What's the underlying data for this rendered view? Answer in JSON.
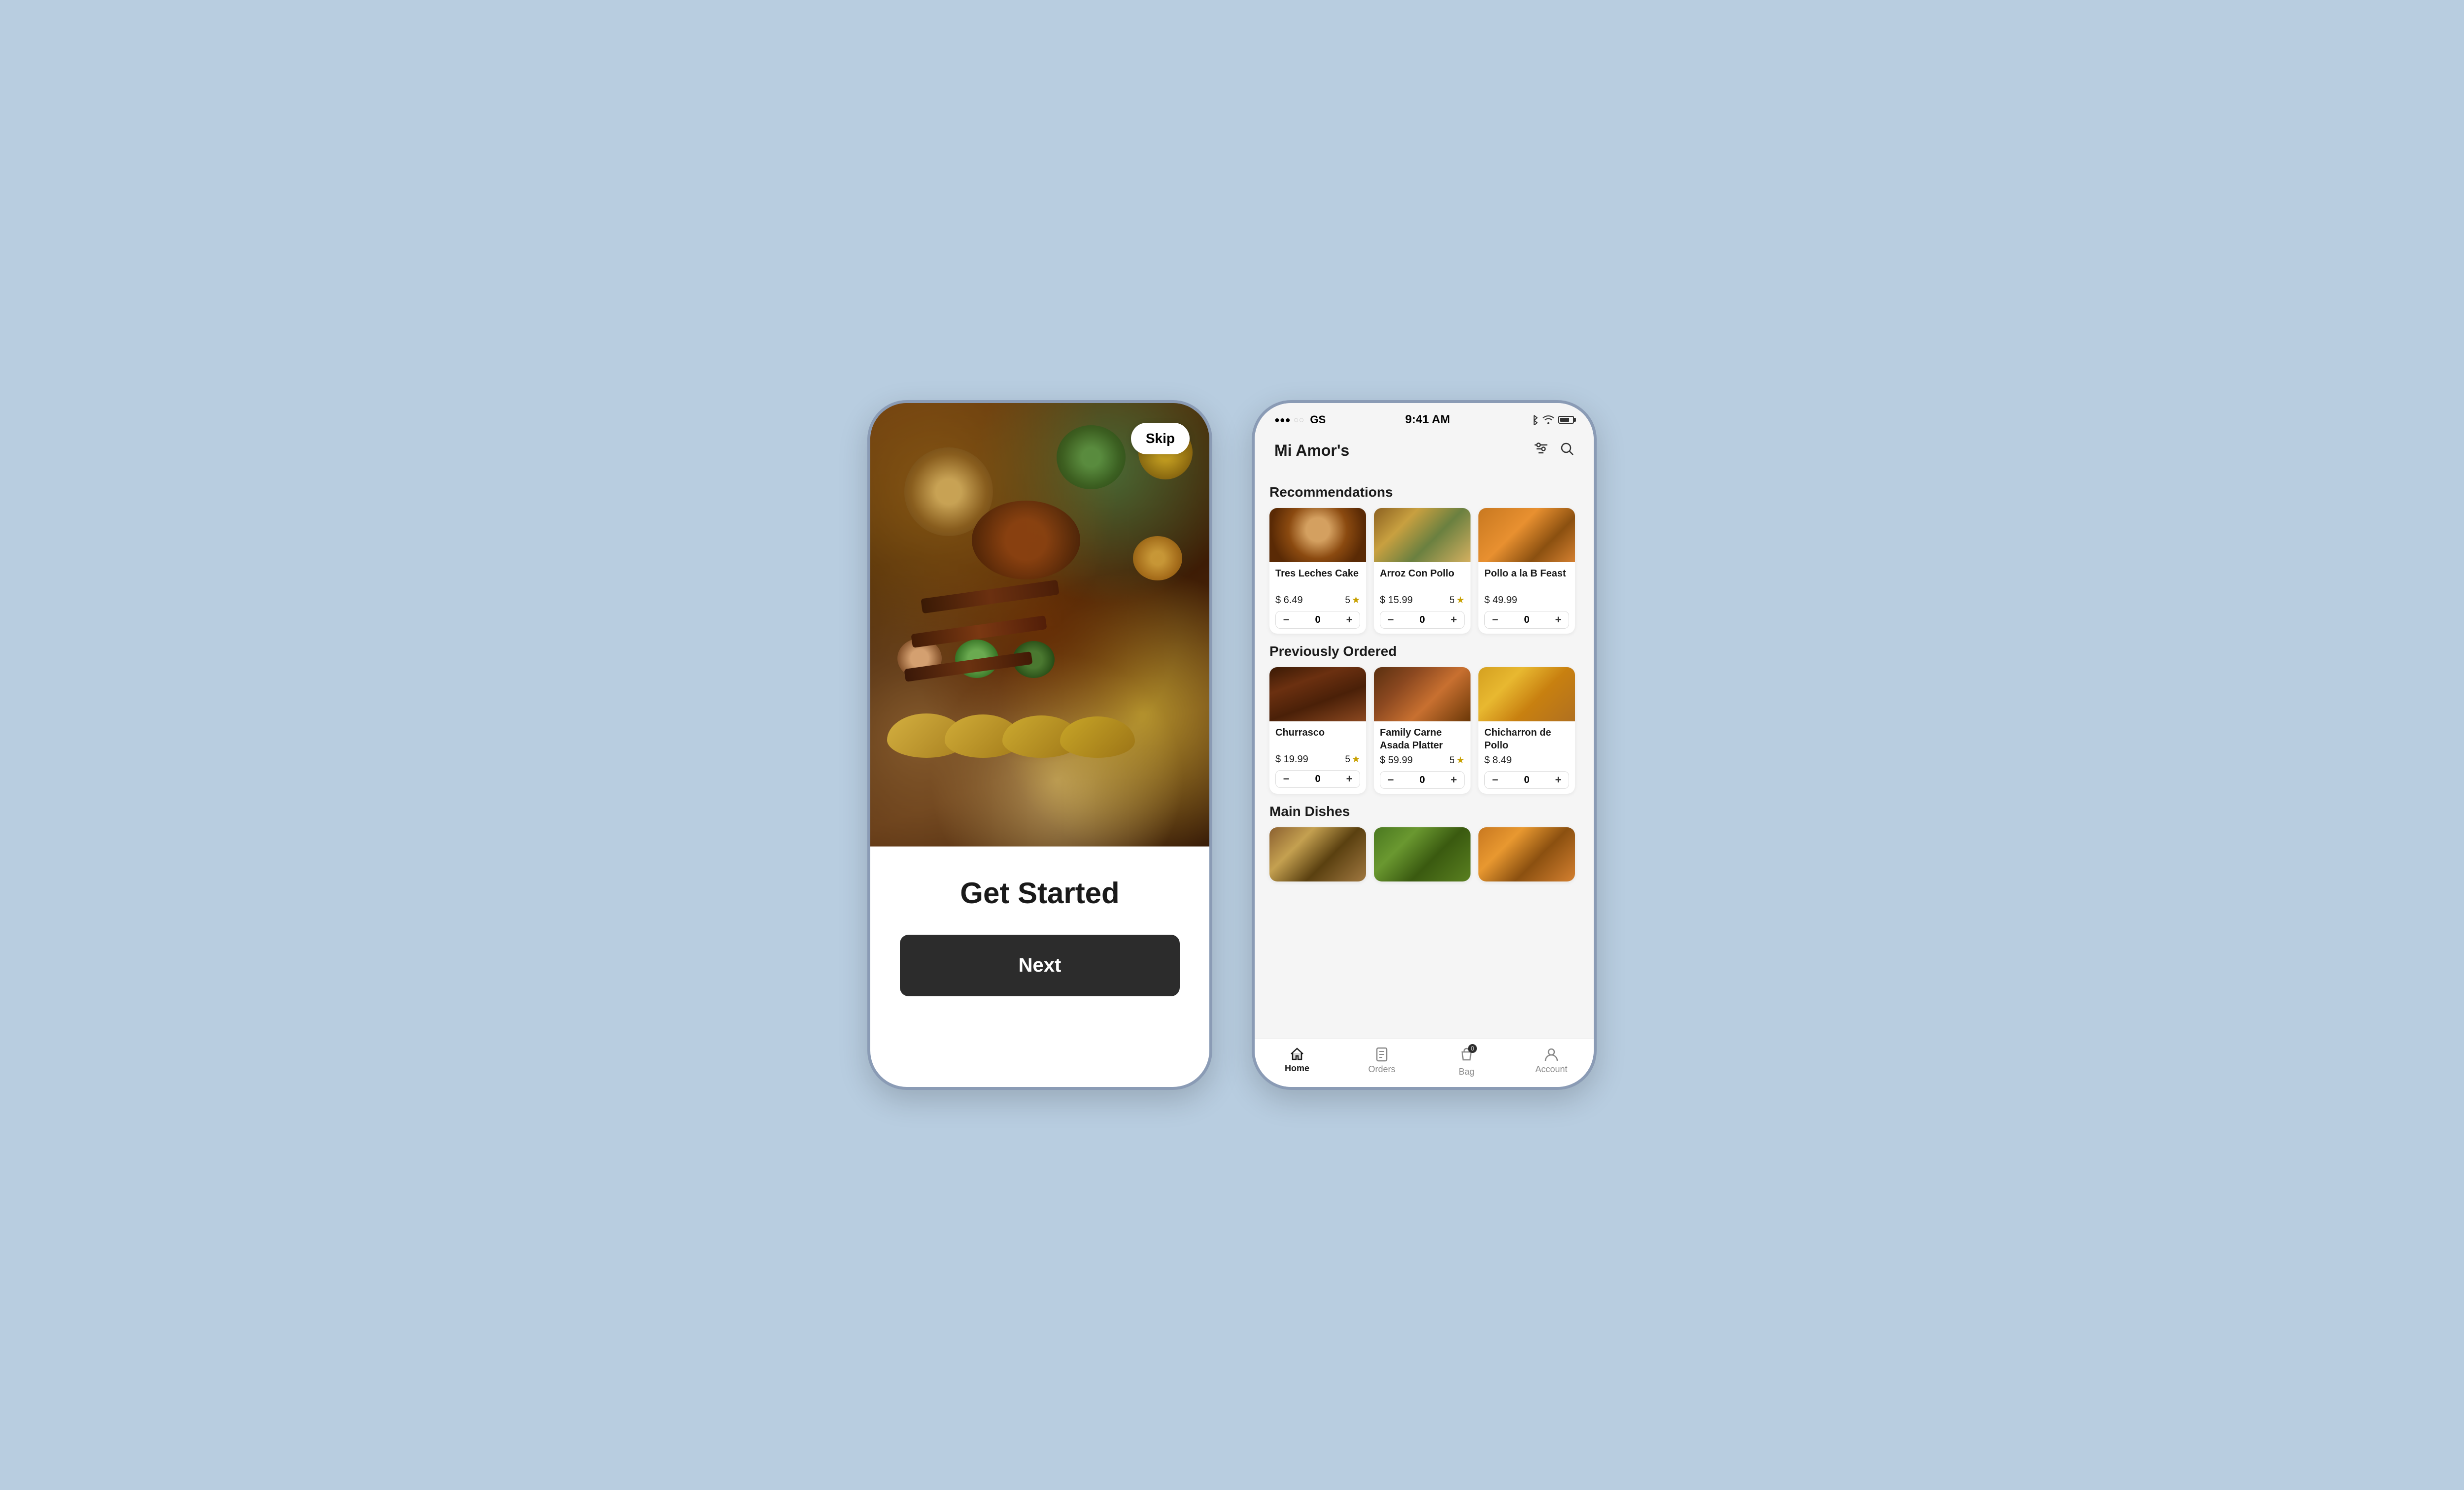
{
  "background_color": "#b8cde0",
  "phone1": {
    "skip_label": "Skip",
    "title": "Get Started",
    "next_button": "Next"
  },
  "phone2": {
    "status_bar": {
      "signal": "●●●○○",
      "carrier": "GS",
      "time": "9:41 AM"
    },
    "header": {
      "restaurant_name": "Mi Amor's",
      "filter_icon": "filter-icon",
      "search_icon": "search-icon"
    },
    "sections": [
      {
        "title": "Recommendations",
        "items": [
          {
            "name": "Tres Leches Cake",
            "price": "$ 6.49",
            "rating": "5",
            "qty": "0",
            "img_class": "img-tres-leches"
          },
          {
            "name": "Arroz Con Pollo",
            "price": "$ 15.99",
            "rating": "5",
            "qty": "0",
            "img_class": "img-arroz"
          },
          {
            "name": "Pollo a la B Feast",
            "price": "$ 49.99",
            "rating": "",
            "qty": "0",
            "img_class": "img-pollo"
          }
        ]
      },
      {
        "title": "Previously Ordered",
        "items": [
          {
            "name": "Churrasco",
            "price": "$ 19.99",
            "rating": "5",
            "qty": "0",
            "img_class": "img-churrasco"
          },
          {
            "name": "Family Carne Asada Platter",
            "price": "$ 59.99",
            "rating": "5",
            "qty": "0",
            "img_class": "img-carne-asada"
          },
          {
            "name": "Chicharron de Pollo",
            "price": "$ 8.49",
            "rating": "",
            "qty": "0",
            "img_class": "img-chicharron"
          }
        ]
      },
      {
        "title": "Main Dishes",
        "items": [
          {
            "name": "",
            "price": "",
            "rating": "",
            "qty": "",
            "img_class": "img-main1"
          },
          {
            "name": "",
            "price": "",
            "rating": "",
            "qty": "",
            "img_class": "img-main2"
          },
          {
            "name": "",
            "price": "",
            "rating": "",
            "qty": "",
            "img_class": "img-main3"
          }
        ]
      }
    ],
    "bottom_nav": [
      {
        "label": "Home",
        "icon": "home-icon",
        "active": true,
        "badge": ""
      },
      {
        "label": "Orders",
        "icon": "orders-icon",
        "active": false,
        "badge": ""
      },
      {
        "label": "Bag",
        "icon": "bag-icon",
        "active": false,
        "badge": "0"
      },
      {
        "label": "Account",
        "icon": "account-icon",
        "active": false,
        "badge": ""
      }
    ]
  }
}
